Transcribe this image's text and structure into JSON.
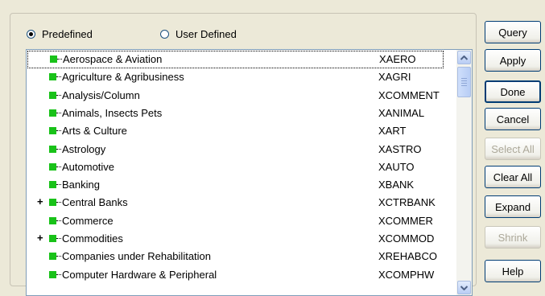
{
  "filter": {
    "predefined_label": "Predefined",
    "user_defined_label": "User Defined",
    "selected": "Predefined"
  },
  "list": {
    "items": [
      {
        "name": "Aerospace & Aviation",
        "code": "XAERO",
        "expandable": false,
        "selected": true
      },
      {
        "name": "Agriculture & Agribusiness",
        "code": "XAGRI",
        "expandable": false,
        "selected": false
      },
      {
        "name": "Analysis/Column",
        "code": "XCOMMENT",
        "expandable": false,
        "selected": false
      },
      {
        "name": "Animals, Insects Pets",
        "code": "XANIMAL",
        "expandable": false,
        "selected": false
      },
      {
        "name": "Arts & Culture",
        "code": "XART",
        "expandable": false,
        "selected": false
      },
      {
        "name": "Astrology",
        "code": "XASTRO",
        "expandable": false,
        "selected": false
      },
      {
        "name": "Automotive",
        "code": "XAUTO",
        "expandable": false,
        "selected": false
      },
      {
        "name": "Banking",
        "code": "XBANK",
        "expandable": false,
        "selected": false
      },
      {
        "name": "Central Banks",
        "code": "XCTRBANK",
        "expandable": true,
        "selected": false
      },
      {
        "name": "Commerce",
        "code": "XCOMMER",
        "expandable": false,
        "selected": false
      },
      {
        "name": "Commodities",
        "code": "XCOMMOD",
        "expandable": true,
        "selected": false
      },
      {
        "name": "Companies under Rehabilitation",
        "code": "XREHABCO",
        "expandable": false,
        "selected": false
      },
      {
        "name": "Computer Hardware & Peripheral",
        "code": "XCOMPHW",
        "expandable": false,
        "selected": false
      }
    ],
    "expand_glyph": "+"
  },
  "buttons": {
    "query": "Query",
    "apply": "Apply",
    "done": "Done",
    "cancel": "Cancel",
    "select_all": "Select All",
    "clear_all": "Clear All",
    "expand": "Expand",
    "shrink": "Shrink",
    "help": "Help"
  },
  "colors": {
    "node": "#19c219",
    "window": "#ece9d8",
    "disabled_text": "#aca899"
  },
  "icons": {
    "scroll_up": "scroll-up-arrow-icon",
    "scroll_down": "scroll-down-arrow-icon",
    "node": "green-square-node-icon"
  }
}
